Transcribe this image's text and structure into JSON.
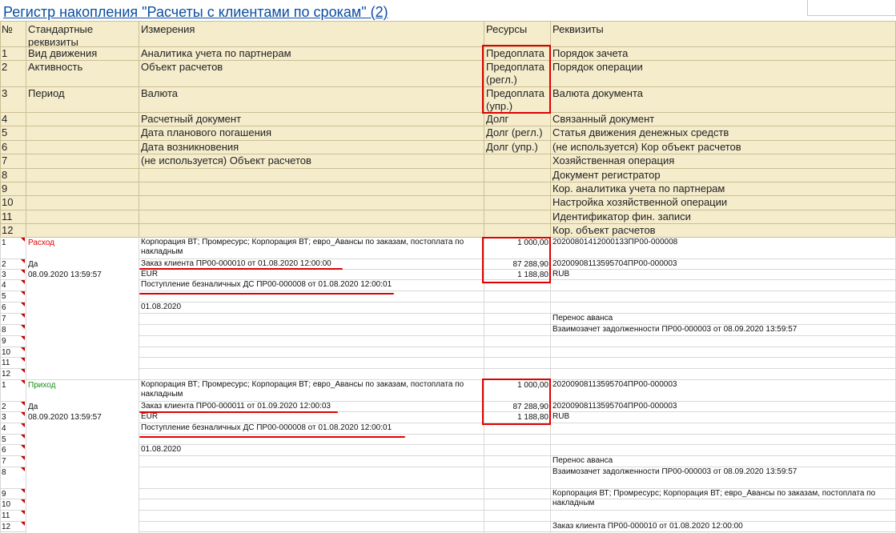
{
  "title": "Регистр накопления \"Расчеты с клиентами по срокам\" (2)",
  "header": {
    "col_no": "№",
    "col_std": "Стандартные реквизиты",
    "col_dim": "Измерения",
    "col_res": "Ресурсы",
    "col_attr": "Реквизиты",
    "rows": [
      {
        "n": "1",
        "std": "Вид движения",
        "dim": "Аналитика учета по партнерам",
        "res": "Предоплата",
        "attr": "Порядок зачета"
      },
      {
        "n": "2",
        "std": "Активность",
        "dim": "Объект расчетов",
        "res": "Предоплата (регл.)",
        "attr": "Порядок операции"
      },
      {
        "n": "3",
        "std": "Период",
        "dim": "Валюта",
        "res": "Предоплата (упр.)",
        "attr": "Валюта документа"
      },
      {
        "n": "4",
        "std": "",
        "dim": "Расчетный документ",
        "res": "Долг",
        "attr": "Связанный документ"
      },
      {
        "n": "5",
        "std": "",
        "dim": "Дата планового погашения",
        "res": "Долг (регл.)",
        "attr": "Статья движения денежных средств"
      },
      {
        "n": "6",
        "std": "",
        "dim": "Дата возникновения",
        "res": "Долг (упр.)",
        "attr": "(не используется) Кор объект расчетов"
      },
      {
        "n": "7",
        "std": "",
        "dim": "(не используется) Объект расчетов",
        "res": "",
        "attr": "Хозяйственная операция"
      },
      {
        "n": "8",
        "std": "",
        "dim": "",
        "res": "",
        "attr": "Документ регистратор"
      },
      {
        "n": "9",
        "std": "",
        "dim": "",
        "res": "",
        "attr": "Кор. аналитика учета по партнерам"
      },
      {
        "n": "10",
        "std": "",
        "dim": "",
        "res": "",
        "attr": "Настройка хозяйственной операции"
      },
      {
        "n": "11",
        "std": "",
        "dim": "",
        "res": "",
        "attr": "Идентификатор фин. записи"
      },
      {
        "n": "12",
        "std": "",
        "dim": "",
        "res": "",
        "attr": "Кор. объект расчетов"
      }
    ]
  },
  "blocks": [
    {
      "movement": "Расход",
      "movement_color": "#e00000",
      "rows": [
        {
          "n": "1",
          "std": "",
          "dim": "Корпорация ВТ; Промресурс; Корпорация ВТ; евро_Авансы по заказам, постоплата по накладным",
          "res": "1 000,00",
          "attr": "20200801412000133ПР00-000008"
        },
        {
          "n": "2",
          "std": "Да",
          "dim": "Заказ клиента ПР00-000010 от 01.08.2020 12:00:00",
          "res": "87 288,90",
          "attr": "20200908113595704ПР00-000003"
        },
        {
          "n": "3",
          "std": "08.09.2020 13:59:57",
          "dim": "EUR",
          "res": "1 188,80",
          "attr": "RUB"
        },
        {
          "n": "4",
          "std": "",
          "dim": "Поступление безналичных ДС ПР00-000008 от 01.08.2020 12:00:01",
          "res": "",
          "attr": ""
        },
        {
          "n": "5",
          "std": "",
          "dim": "",
          "res": "",
          "attr": ""
        },
        {
          "n": "6",
          "std": "",
          "dim": "01.08.2020",
          "res": "",
          "attr": ""
        },
        {
          "n": "7",
          "std": "",
          "dim": "",
          "res": "",
          "attr": "Перенос аванса"
        },
        {
          "n": "8",
          "std": "",
          "dim": "",
          "res": "",
          "attr": "Взаимозачет задолженности ПР00-000003 от 08.09.2020 13:59:57"
        },
        {
          "n": "9",
          "std": "",
          "dim": "",
          "res": "",
          "attr": ""
        },
        {
          "n": "10",
          "std": "",
          "dim": "",
          "res": "",
          "attr": ""
        },
        {
          "n": "11",
          "std": "",
          "dim": "",
          "res": "",
          "attr": ""
        },
        {
          "n": "12",
          "std": "",
          "dim": "",
          "res": "",
          "attr": ""
        }
      ]
    },
    {
      "movement": "Приход",
      "movement_color": "#1a8f1a",
      "rows": [
        {
          "n": "1",
          "std": "",
          "dim": "Корпорация ВТ; Промресурс; Корпорация ВТ; евро_Авансы по заказам, постоплата по накладным",
          "res": "1 000,00",
          "attr": "20200908113595704ПР00-000003"
        },
        {
          "n": "2",
          "std": "Да",
          "dim": "Заказ клиента ПР00-000011 от 01.09.2020 12:00:03",
          "res": "87 288,90",
          "attr": "20200908113595704ПР00-000003"
        },
        {
          "n": "3",
          "std": "08.09.2020 13:59:57",
          "dim": "EUR",
          "res": "1 188,80",
          "attr": "RUB"
        },
        {
          "n": "4",
          "std": "",
          "dim": "Поступление безналичных ДС ПР00-000008 от 01.08.2020 12:00:01",
          "res": "",
          "attr": ""
        },
        {
          "n": "5",
          "std": "",
          "dim": "",
          "res": "",
          "attr": ""
        },
        {
          "n": "6",
          "std": "",
          "dim": "01.08.2020",
          "res": "",
          "attr": ""
        },
        {
          "n": "7",
          "std": "",
          "dim": "",
          "res": "",
          "attr": "Перенос аванса"
        },
        {
          "n": "8",
          "std": "",
          "dim": "",
          "res": "",
          "attr": "Взаимозачет задолженности ПР00-000003 от 08.09.2020 13:59:57"
        },
        {
          "n": "9",
          "std": "",
          "dim": "",
          "res": "",
          "attr": "Корпорация ВТ; Промресурс; Корпорация ВТ; евро_Авансы по заказам, постоплата по накладным"
        },
        {
          "n": "10",
          "std": "",
          "dim": "",
          "res": "",
          "attr": ""
        },
        {
          "n": "11",
          "std": "",
          "dim": "",
          "res": "",
          "attr": ""
        },
        {
          "n": "12",
          "std": "",
          "dim": "",
          "res": "",
          "attr": "Заказ клиента ПР00-000010 от 01.08.2020 12:00:00"
        }
      ]
    }
  ],
  "colors": {
    "header_bg": "#f5eccc",
    "grid": "#c9bf96",
    "grid_light": "#d8d8d8",
    "title": "#0b4ea2",
    "highlight": "#e00000"
  }
}
